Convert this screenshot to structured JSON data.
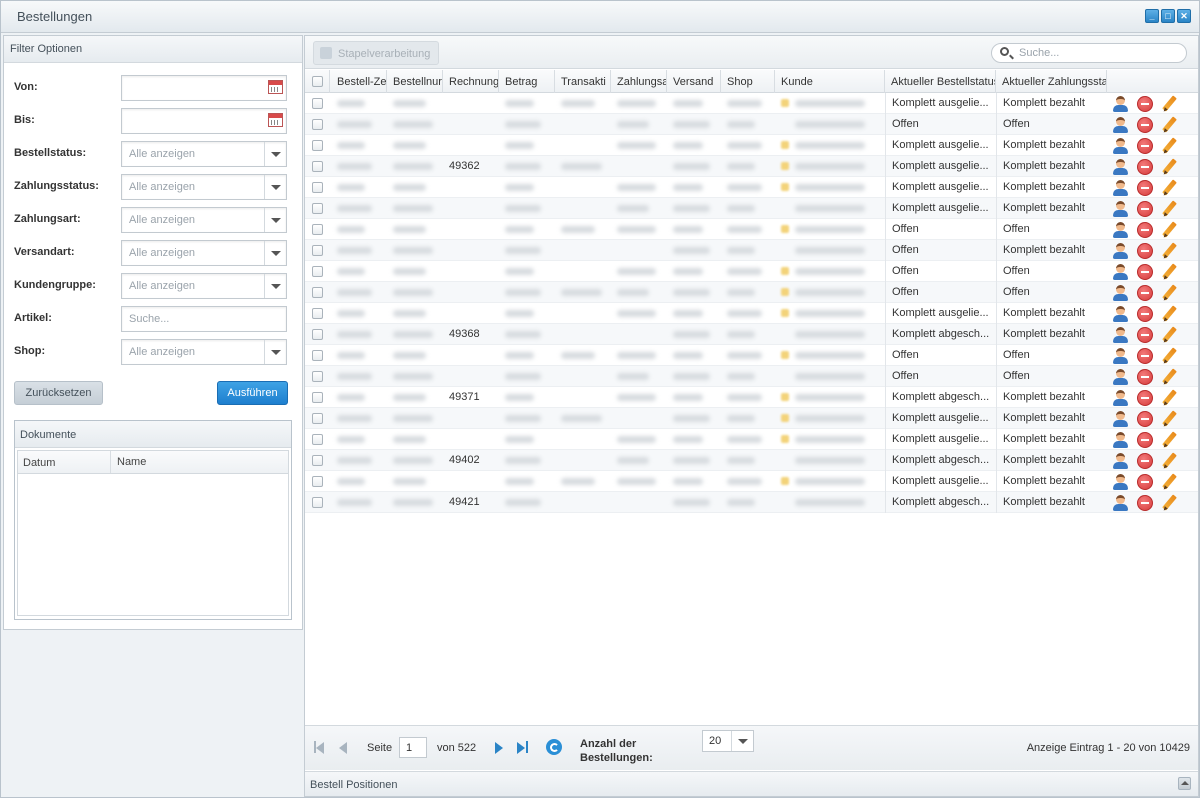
{
  "window": {
    "title": "Bestellungen"
  },
  "filter": {
    "title": "Filter Optionen",
    "fields": [
      {
        "label": "Von:",
        "value": "",
        "kind": "date"
      },
      {
        "label": "Bis:",
        "value": "",
        "kind": "date"
      },
      {
        "label": "Bestellstatus:",
        "value": "Alle anzeigen",
        "kind": "select"
      },
      {
        "label": "Zahlungsstatus:",
        "value": "Alle anzeigen",
        "kind": "select"
      },
      {
        "label": "Zahlungsart:",
        "value": "Alle anzeigen",
        "kind": "select"
      },
      {
        "label": "Versandart:",
        "value": "Alle anzeigen",
        "kind": "select"
      },
      {
        "label": "Kundengruppe:",
        "value": "Alle anzeigen",
        "kind": "select"
      },
      {
        "label": "Artikel:",
        "value": "Suche...",
        "kind": "text"
      },
      {
        "label": "Shop:",
        "value": "Alle anzeigen",
        "kind": "select"
      }
    ],
    "reset_label": "Zurücksetzen",
    "run_label": "Ausführen"
  },
  "documents": {
    "title": "Dokumente",
    "col_date": "Datum",
    "col_name": "Name"
  },
  "toolbar": {
    "batch_label": "Stapelverarbeitung",
    "search_placeholder": "Suche..."
  },
  "grid": {
    "columns": [
      "Bestell-Ze",
      "Bestellnur",
      "Rechnung",
      "Betrag",
      "Transakti",
      "Zahlungsa",
      "Versand",
      "Shop",
      "Kunde",
      "Aktueller Bestellstatus",
      "Aktueller Zahlungssta"
    ],
    "rows": [
      {
        "invoice": "",
        "order_status": "Komplett ausgelie...",
        "payment_status": "Komplett bezahlt"
      },
      {
        "invoice": "",
        "order_status": "Offen",
        "payment_status": "Offen"
      },
      {
        "invoice": "",
        "order_status": "Komplett ausgelie...",
        "payment_status": "Komplett bezahlt"
      },
      {
        "invoice": "49362",
        "order_status": "Komplett ausgelie...",
        "payment_status": "Komplett bezahlt"
      },
      {
        "invoice": "",
        "order_status": "Komplett ausgelie...",
        "payment_status": "Komplett bezahlt"
      },
      {
        "invoice": "",
        "order_status": "Komplett ausgelie...",
        "payment_status": "Komplett bezahlt"
      },
      {
        "invoice": "",
        "order_status": "Offen",
        "payment_status": "Offen"
      },
      {
        "invoice": "",
        "order_status": "Offen",
        "payment_status": "Komplett bezahlt"
      },
      {
        "invoice": "",
        "order_status": "Offen",
        "payment_status": "Offen"
      },
      {
        "invoice": "",
        "order_status": "Offen",
        "payment_status": "Offen"
      },
      {
        "invoice": "",
        "order_status": "Komplett ausgelie...",
        "payment_status": "Komplett bezahlt"
      },
      {
        "invoice": "49368",
        "order_status": "Komplett abgesch...",
        "payment_status": "Komplett bezahlt"
      },
      {
        "invoice": "",
        "order_status": "Offen",
        "payment_status": "Offen"
      },
      {
        "invoice": "",
        "order_status": "Offen",
        "payment_status": "Offen"
      },
      {
        "invoice": "49371",
        "order_status": "Komplett abgesch...",
        "payment_status": "Komplett bezahlt"
      },
      {
        "invoice": "",
        "order_status": "Komplett ausgelie...",
        "payment_status": "Komplett bezahlt"
      },
      {
        "invoice": "",
        "order_status": "Komplett ausgelie...",
        "payment_status": "Komplett bezahlt"
      },
      {
        "invoice": "49402",
        "order_status": "Komplett abgesch...",
        "payment_status": "Komplett bezahlt"
      },
      {
        "invoice": "",
        "order_status": "Komplett ausgelie...",
        "payment_status": "Komplett bezahlt"
      },
      {
        "invoice": "49421",
        "order_status": "Komplett abgesch...",
        "payment_status": "Komplett bezahlt"
      }
    ]
  },
  "pager": {
    "page_label": "Seite",
    "page_value": "1",
    "of_label": "von 522",
    "count_label_1": "Anzahl der",
    "count_label_2": "Bestellungen:",
    "per_page": "20",
    "info": "Anzeige Eintrag 1 - 20 von 10429"
  },
  "footer": {
    "title": "Bestell Positionen"
  }
}
